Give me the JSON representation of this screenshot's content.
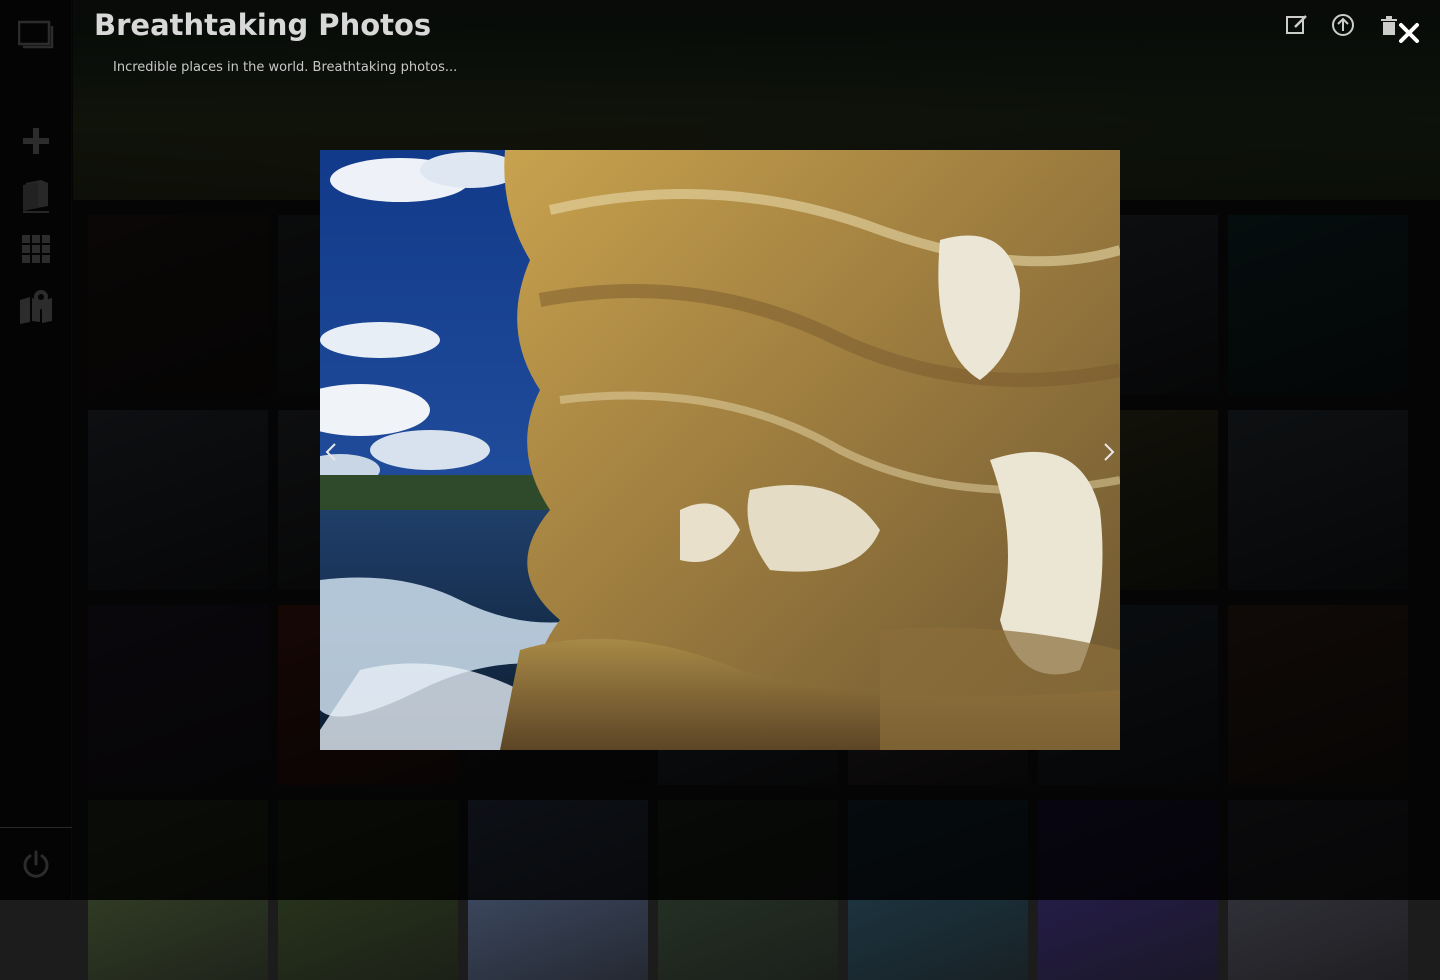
{
  "album": {
    "title": "Breathtaking Photos",
    "description": "Incredible places in the world. Breathtaking photos..."
  },
  "sidebar": {
    "items": [
      {
        "icon": "gallery-icon",
        "label": "Gallery"
      },
      {
        "icon": "plus-icon",
        "label": "Add"
      },
      {
        "icon": "albums-icon",
        "label": "Albums"
      },
      {
        "icon": "grid-icon",
        "label": "Grid"
      },
      {
        "icon": "map-icon",
        "label": "Map"
      },
      {
        "icon": "power-icon",
        "label": "Log out"
      }
    ]
  },
  "top_actions": [
    {
      "icon": "edit-icon"
    },
    {
      "icon": "upload-icon"
    },
    {
      "icon": "trash-icon"
    }
  ],
  "lightbox": {
    "close_icon": "close-icon",
    "prev_icon": "chevron-left-icon",
    "next_icon": "chevron-right-icon"
  },
  "thumbnails": [
    "#3a2a24",
    "#3b3f43",
    "#2f3e4a",
    "#32444f",
    "#3d4b56",
    "#4a5561",
    "#1f4a4e",
    "#4b5563",
    "#4a4f55",
    "#4c5560",
    "#556270",
    "#607080",
    "#6a6a3a",
    "#4c5a66",
    "#3a2a45",
    "#7a2a1e",
    "#2a2a2a",
    "#505a66",
    "#6a5a5a",
    "#3a4a5a",
    "#5a3a2a",
    "#3a4a2a",
    "#2e3e1e",
    "#4a5a7a",
    "#2a3a2a",
    "#1f3f4f",
    "#2a1f5a",
    "#3a3a45"
  ]
}
